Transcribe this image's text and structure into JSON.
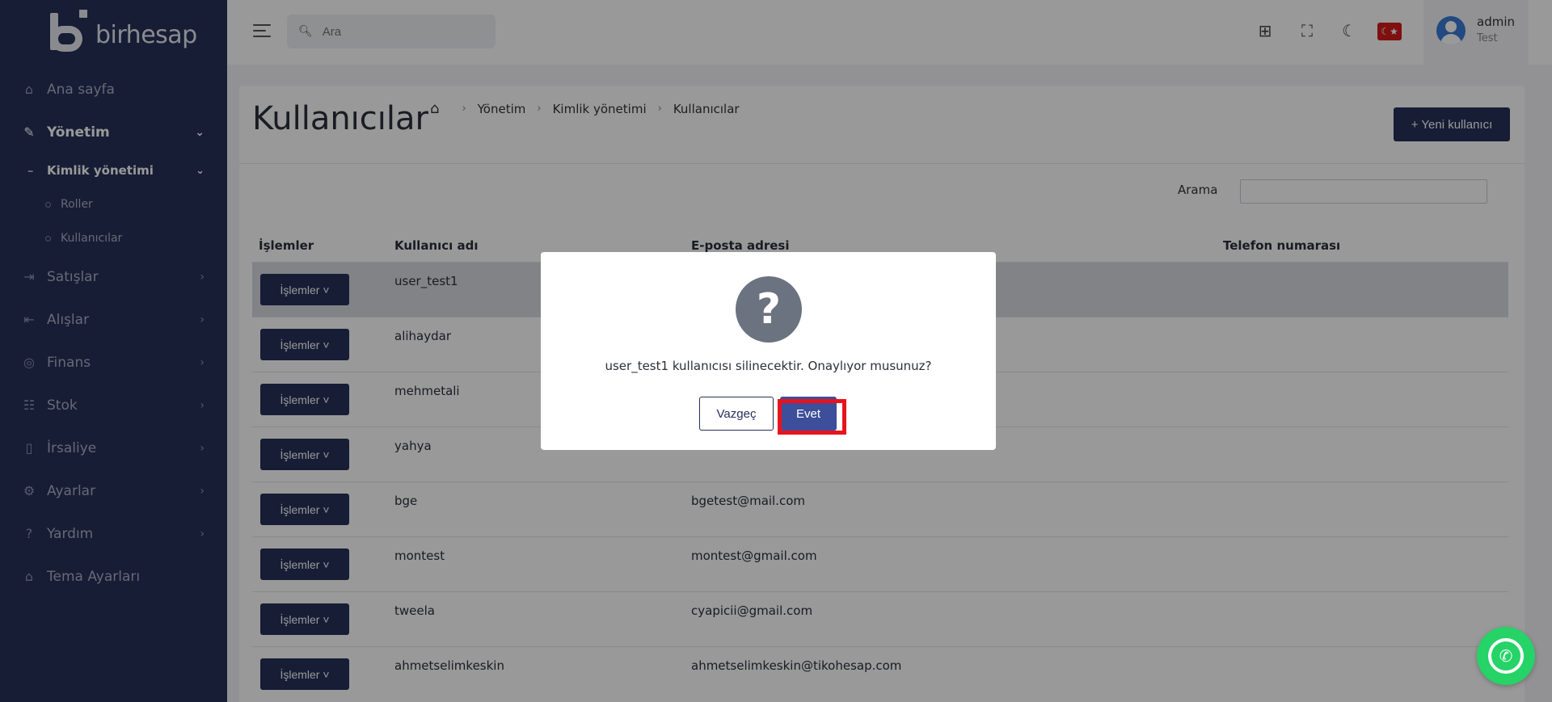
{
  "app": {
    "logo_text": "birhesap"
  },
  "sidebar": {
    "items": [
      {
        "label": "Ana sayfa",
        "icon": "home-icon",
        "glyph": "⌂"
      },
      {
        "label": "Yönetim",
        "icon": "wrench-icon",
        "glyph": "🔧",
        "expanded": true
      },
      {
        "label": "Satışlar",
        "icon": "arrow-in-icon",
        "glyph": "⇥"
      },
      {
        "label": "Alışlar",
        "icon": "arrow-out-icon",
        "glyph": "⇤"
      },
      {
        "label": "Finans",
        "icon": "money-icon",
        "glyph": "◎"
      },
      {
        "label": "Stok",
        "icon": "stock-icon",
        "glyph": "☷"
      },
      {
        "label": "İrsaliye",
        "icon": "document-icon",
        "glyph": "▯"
      },
      {
        "label": "Ayarlar",
        "icon": "gear-icon",
        "glyph": "⚙"
      },
      {
        "label": "Yardım",
        "icon": "help-icon",
        "glyph": "?"
      },
      {
        "label": "Tema Ayarları",
        "icon": "theme-icon",
        "glyph": "⌂"
      }
    ],
    "sub": {
      "label": "Kimlik yönetimi"
    },
    "subsub": [
      {
        "label": "Roller"
      },
      {
        "label": "Kullanıcılar"
      }
    ]
  },
  "header": {
    "search": {
      "placeholder": "Ara"
    },
    "user": {
      "name": "admin",
      "role": "Test"
    },
    "flag": "☾★"
  },
  "page": {
    "title": "Kullanıcılar",
    "breadcrumb": [
      "Yönetim",
      "Kimlik yönetimi",
      "Kullanıcılar"
    ],
    "new_user_label": "+ Yeni kullanıcı",
    "search_label": "Arama"
  },
  "table": {
    "headers": {
      "actions": "İşlemler",
      "username": "Kullanıcı adı",
      "email": "E-posta adresi",
      "phone": "Telefon numarası"
    },
    "action_label": "İşlemler ˅",
    "rows": [
      {
        "username": "user_test1",
        "email": ""
      },
      {
        "username": "alihaydar",
        "email": ""
      },
      {
        "username": "mehmetali",
        "email": ""
      },
      {
        "username": "yahya",
        "email": ""
      },
      {
        "username": "bge",
        "email": "bgetest@mail.com"
      },
      {
        "username": "montest",
        "email": "montest@gmail.com"
      },
      {
        "username": "tweela",
        "email": "cyapicii@gmail.com"
      },
      {
        "username": "ahmetselimkeskin",
        "email": "ahmetselimkeskin@tikohesap.com"
      }
    ]
  },
  "modal": {
    "message": "user_test1 kullanıcısı silinecektir. Onaylıyor musunuz?",
    "cancel_label": "Vazgeç",
    "confirm_label": "Evet"
  },
  "colors": {
    "sidebar": "#263159",
    "primary": "#263159",
    "confirm": "#3d4f9a",
    "highlight": "#e8131c",
    "whatsapp": "#25d366"
  }
}
